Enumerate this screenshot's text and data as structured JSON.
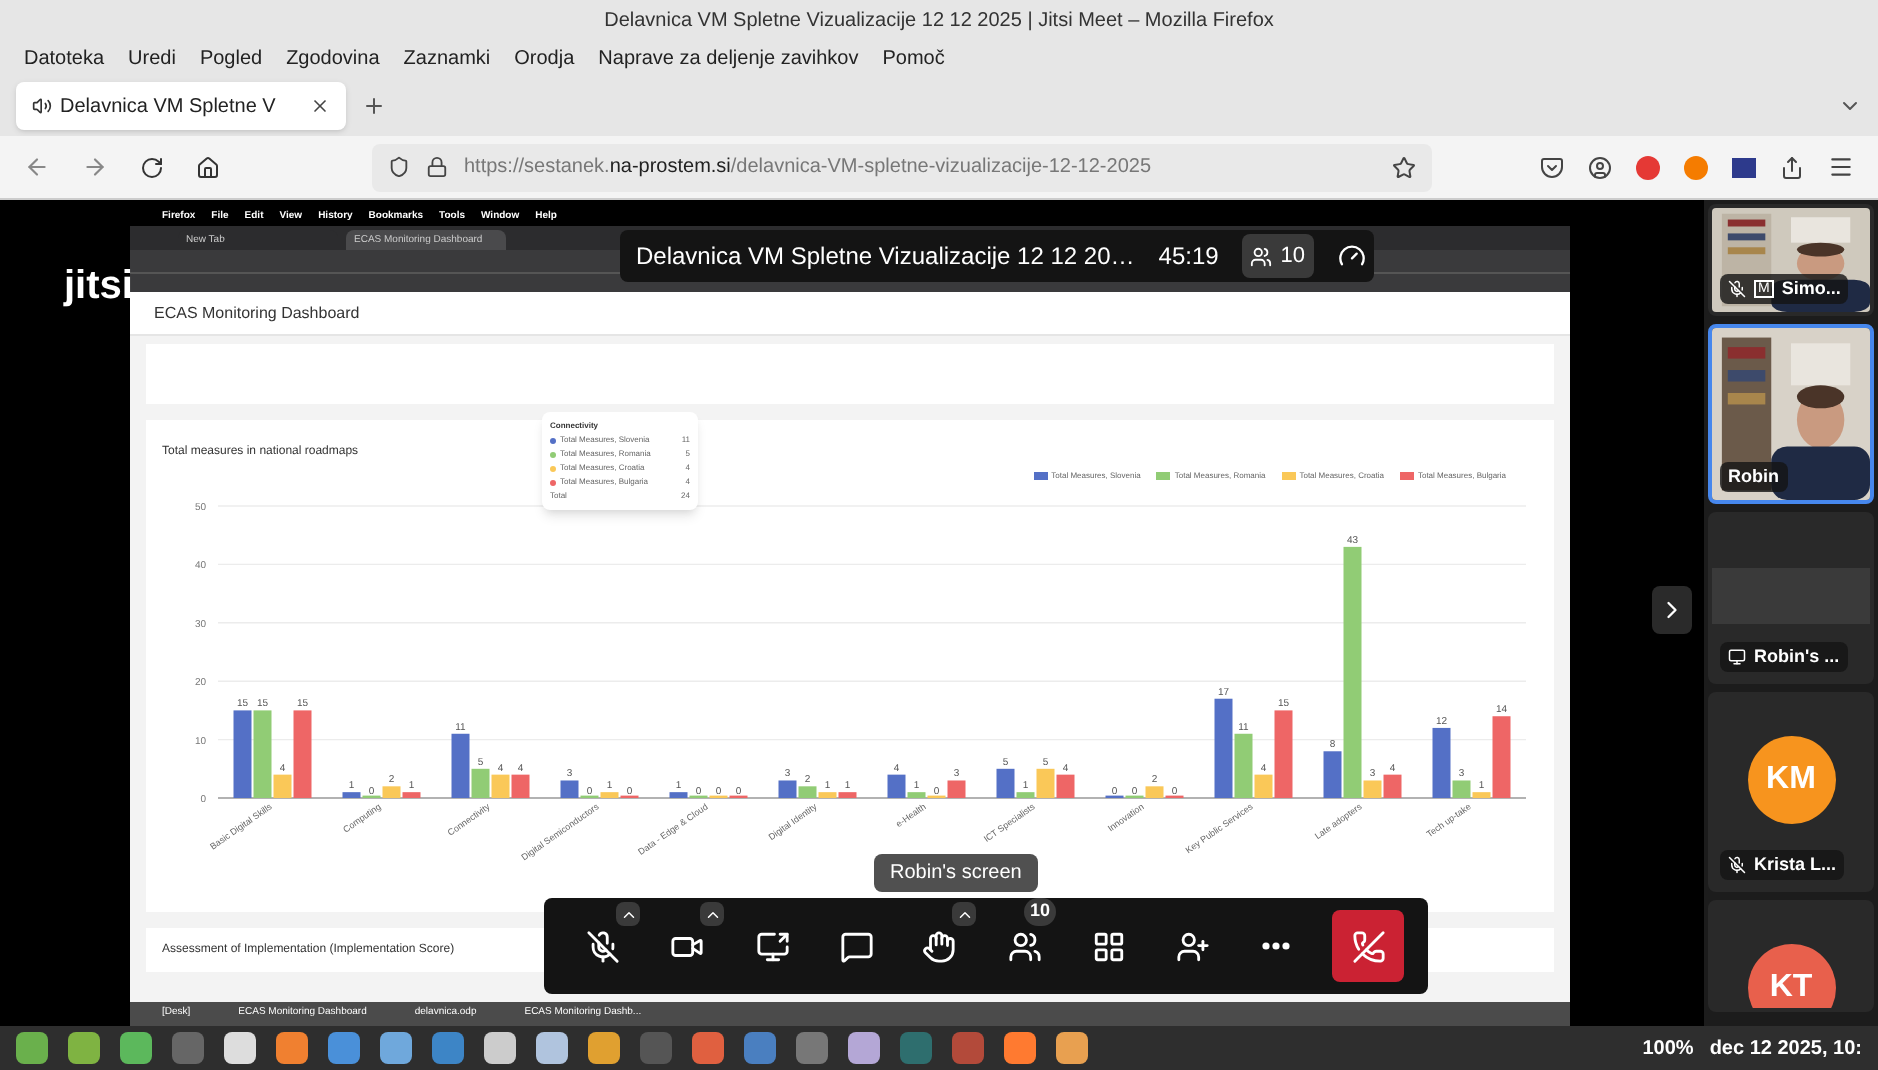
{
  "window": {
    "title": "Delavnica VM Spletne Vizualizacije 12 12 2025 | Jitsi Meet – Mozilla Firefox"
  },
  "menu": [
    "Datoteka",
    "Uredi",
    "Pogled",
    "Zgodovina",
    "Zaznamki",
    "Orodja",
    "Naprave za deljenje zavihkov",
    "Pomoč"
  ],
  "tabs": [
    {
      "label": "Delavnica VM Spletne V",
      "selected": true
    }
  ],
  "address": {
    "prefix": "https://sestanek.",
    "domain": "na-prostem.si",
    "path": "/delavnica-VM-spletne-vizualizacije-12-12-2025"
  },
  "meeting": {
    "logo": "jitsi",
    "title": "Delavnica VM Spletne Vizualizacije 12 12 20…",
    "timer": "45:19",
    "participants": "10"
  },
  "shared_screen": {
    "menu": [
      "Firefox",
      "File",
      "Edit",
      "View",
      "History",
      "Bookmarks",
      "Tools",
      "Window",
      "Help"
    ],
    "tabs": [
      {
        "label": "New Tab",
        "selected": false
      },
      {
        "label": "ECAS Monitoring Dashboard",
        "selected": true
      }
    ],
    "page_title": "ECAS Monitoring Dashboard",
    "chart_card": {
      "title": "Total measures in national roadmaps",
      "tooltip": {
        "title": "Connectivity",
        "rows": [
          {
            "label": "Total Measures, Slovenia",
            "value": "11",
            "color": "#5470c6"
          },
          {
            "label": "Total Measures, Romania",
            "value": "5",
            "color": "#91cc75"
          },
          {
            "label": "Total Measures, Croatia",
            "value": "4",
            "color": "#fac858"
          },
          {
            "label": "Total Measures, Bulgaria",
            "value": "4",
            "color": "#ee6666"
          }
        ],
        "total_label": "Total",
        "total": "24"
      },
      "chart_data": {
        "type": "bar",
        "categories": [
          "Basic Digital Skills",
          "Computing",
          "Connectivity",
          "Digital Semiconductors",
          "Data - Edge & Cloud",
          "Digital Identity",
          "e-Health",
          "ICT Specialists",
          "Innovation",
          "Key Public Services",
          "Late adopters",
          "Tech up-take"
        ],
        "series": [
          {
            "name": "Total Measures, Slovenia",
            "color": "#5470c6",
            "values": [
              15,
              1,
              11,
              3,
              1,
              3,
              4,
              5,
              0,
              17,
              8,
              12
            ]
          },
          {
            "name": "Total Measures, Romania",
            "color": "#91cc75",
            "values": [
              15,
              0,
              5,
              0,
              0,
              2,
              1,
              1,
              0,
              11,
              43,
              3
            ]
          },
          {
            "name": "Total Measures, Croatia",
            "color": "#fac858",
            "values": [
              4,
              2,
              4,
              1,
              0,
              1,
              0,
              5,
              2,
              4,
              3,
              1
            ]
          },
          {
            "name": "Total Measures, Bulgaria",
            "color": "#ee6666",
            "values": [
              15,
              1,
              4,
              0,
              0,
              1,
              3,
              4,
              0,
              15,
              4,
              14
            ]
          }
        ],
        "ylim": [
          0,
          50
        ],
        "yticks": [
          0,
          10,
          20,
          30,
          40,
          50
        ],
        "grid": true,
        "data_labels": true
      }
    },
    "second_card_title": "Assessment of Implementation (Implementation Score)",
    "taskbar": [
      "[Desk]",
      "ECAS Monitoring Dashboard",
      "delavnica.odp",
      "ECAS Monitoring Dashb..."
    ]
  },
  "screen_label": "Robin's screen",
  "toolbar": [
    {
      "kind": "mic-off",
      "caret": true
    },
    {
      "kind": "camera",
      "caret": true
    },
    {
      "kind": "share",
      "caret": false
    },
    {
      "kind": "chat",
      "caret": false
    },
    {
      "kind": "hand",
      "caret": true
    },
    {
      "kind": "participants",
      "caret": false,
      "badge": "10"
    },
    {
      "kind": "tiles",
      "caret": false
    },
    {
      "kind": "invite",
      "caret": false
    },
    {
      "kind": "more",
      "caret": false
    },
    {
      "kind": "hangup",
      "caret": false
    }
  ],
  "filmstrip": [
    {
      "kind": "video",
      "name": "Simo...",
      "muted": true,
      "badge": "M",
      "selected": false
    },
    {
      "kind": "video",
      "name": "Robin",
      "muted": false,
      "selected": true
    },
    {
      "kind": "screen",
      "name": "Robin's ...",
      "muted": false,
      "selected": false
    },
    {
      "kind": "avatar",
      "initials": "KM",
      "color": "#f7941e",
      "name": "Krista L...",
      "muted": true,
      "selected": false
    },
    {
      "kind": "avatar",
      "initials": "KT",
      "color": "#e8604c",
      "selected": false
    }
  ],
  "os_taskbar": {
    "battery": "100%",
    "clock": "dec 12 2025, 10:"
  }
}
